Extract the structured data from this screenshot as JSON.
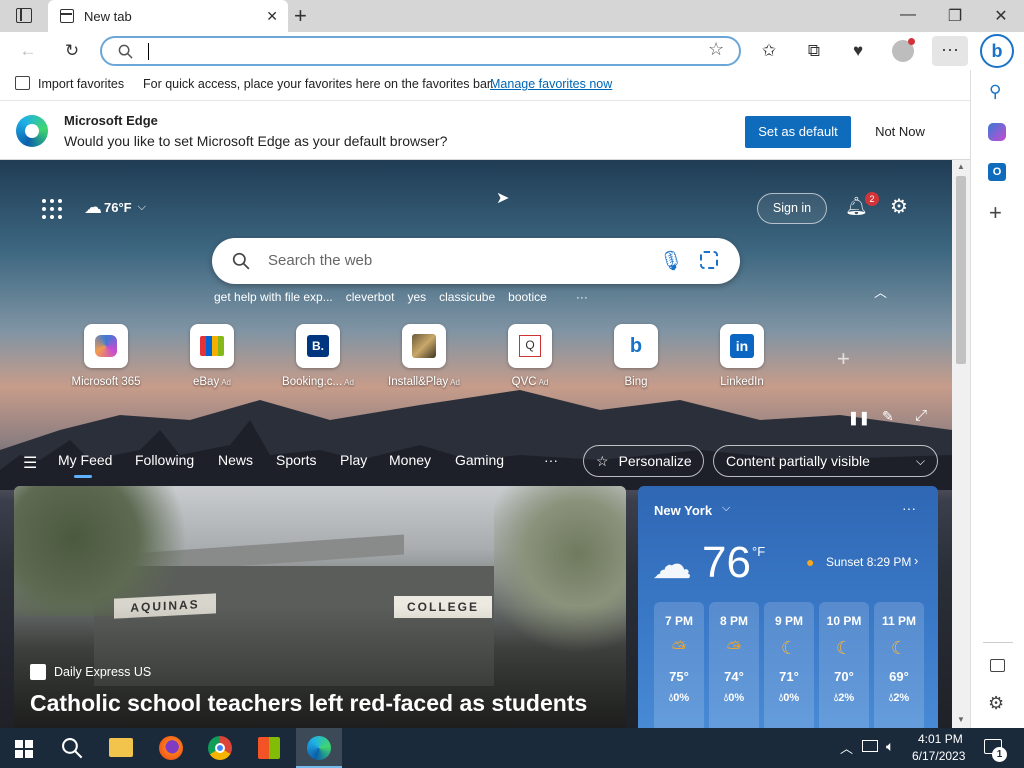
{
  "browser": {
    "tab_title": "New tab",
    "address_value": "",
    "favbar": {
      "import_label": "Import favorites",
      "hint_text": "For quick access, place your favorites here on the favorites bar.",
      "manage_link": "Manage favorites now"
    },
    "infobar": {
      "title": "Microsoft Edge",
      "message": "Would you like to set Microsoft Edge as your default browser?",
      "set_default_label": "Set as default",
      "not_now_label": "Not Now"
    }
  },
  "newtab": {
    "weather_chip": "76°F",
    "sign_in_label": "Sign in",
    "notification_count": "2",
    "search_placeholder": "Search the web",
    "suggestions": [
      "get help with file exp...",
      "cleverbot",
      "yes",
      "classicube",
      "bootice",
      "···"
    ],
    "shortcuts": [
      {
        "label": "Microsoft 365",
        "ad": ""
      },
      {
        "label": "eBay",
        "ad": "Ad"
      },
      {
        "label": "Booking.c...",
        "ad": "Ad"
      },
      {
        "label": "Install&Play",
        "ad": "Ad"
      },
      {
        "label": "QVC",
        "ad": "Ad"
      },
      {
        "label": "Bing",
        "ad": ""
      },
      {
        "label": "LinkedIn",
        "ad": ""
      }
    ],
    "nav": [
      "My Feed",
      "Following",
      "News",
      "Sports",
      "Play",
      "Money",
      "Gaming",
      "···"
    ],
    "personalize_label": "Personalize",
    "content_visibility_label": "Content partially visible",
    "article": {
      "source": "Daily Express US",
      "headline": "Catholic school teachers left red-faced as students",
      "sign_left": "AQUINAS",
      "sign_right": "COLLEGE"
    },
    "weather": {
      "city": "New York",
      "temp": "76",
      "unit": "°F",
      "sunset": "Sunset 8:29 PM",
      "hours": [
        {
          "time": "7 PM",
          "temp": "75°",
          "precip": "0%",
          "icon": "partly-sunny-icon"
        },
        {
          "time": "8 PM",
          "temp": "74°",
          "precip": "0%",
          "icon": "partly-sunny-icon"
        },
        {
          "time": "9 PM",
          "temp": "71°",
          "precip": "0%",
          "icon": "moon-icon"
        },
        {
          "time": "10 PM",
          "temp": "70°",
          "precip": "2%",
          "icon": "cloudy-moon-icon"
        },
        {
          "time": "11 PM",
          "temp": "69°",
          "precip": "2%",
          "icon": "moon-icon"
        }
      ]
    }
  },
  "taskbar": {
    "time": "4:01 PM",
    "date": "6/17/2023",
    "notification_count": "1"
  },
  "colors": {
    "accent": "#0f6cbd",
    "link": "#0066b4",
    "badge": "#d13438"
  }
}
